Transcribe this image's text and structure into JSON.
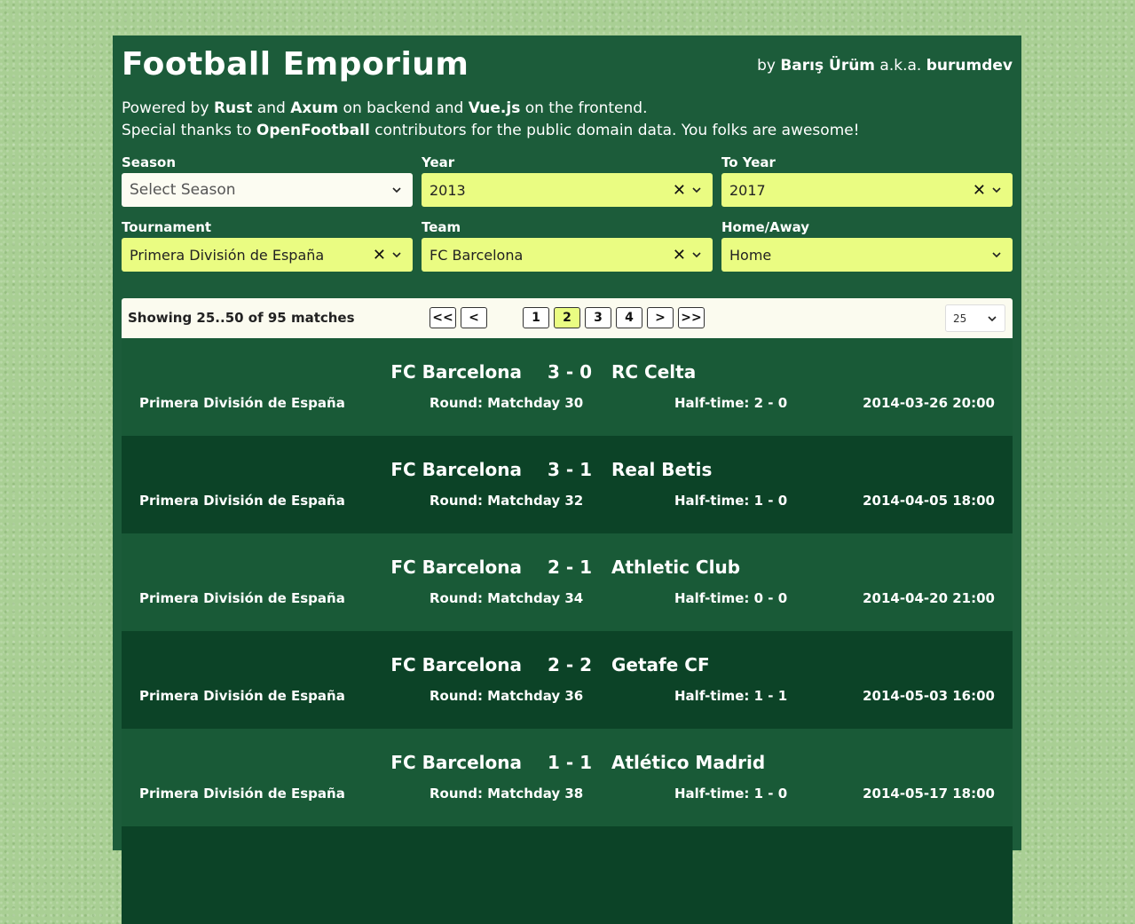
{
  "header": {
    "title": "Football Emporium",
    "by_prefix": "by ",
    "author": "Barış Ürüm",
    "aka": " a.k.a. ",
    "handle": "burumdev"
  },
  "intro": {
    "line1": [
      "Powered by ",
      "Rust",
      " and ",
      "Axum",
      " on backend and ",
      "Vue.js",
      " on the frontend."
    ],
    "line2": [
      "Special thanks to ",
      "OpenFootball",
      " contributors for the public domain data. You folks are awesome!"
    ]
  },
  "filters": {
    "season": {
      "label": "Season",
      "placeholder": "Select Season"
    },
    "year": {
      "label": "Year",
      "value": "2013"
    },
    "to_year": {
      "label": "To Year",
      "value": "2017"
    },
    "tournament": {
      "label": "Tournament",
      "value": "Primera División de España"
    },
    "team": {
      "label": "Team",
      "value": "FC Barcelona"
    },
    "home_away": {
      "label": "Home/Away",
      "value": "Home"
    }
  },
  "pager": {
    "showing": "Showing 25..50 of 95 matches",
    "first": "<<",
    "prev": "<",
    "pages": [
      "1",
      "2",
      "3",
      "4"
    ],
    "current_page": "2",
    "next": ">",
    "last": ">>",
    "per_page": "25"
  },
  "matches": [
    {
      "home": "FC Barcelona",
      "score": "3 - 0",
      "away": "RC Celta",
      "tournament": "Primera División de España",
      "round": "Round: Matchday 30",
      "halftime": "Half-time: 2 - 0",
      "date": "2014-03-26 20:00"
    },
    {
      "home": "FC Barcelona",
      "score": "3 - 1",
      "away": "Real Betis",
      "tournament": "Primera División de España",
      "round": "Round: Matchday 32",
      "halftime": "Half-time: 1 - 0",
      "date": "2014-04-05 18:00"
    },
    {
      "home": "FC Barcelona",
      "score": "2 - 1",
      "away": "Athletic Club",
      "tournament": "Primera División de España",
      "round": "Round: Matchday 34",
      "halftime": "Half-time: 0 - 0",
      "date": "2014-04-20 21:00"
    },
    {
      "home": "FC Barcelona",
      "score": "2 - 2",
      "away": "Getafe CF",
      "tournament": "Primera División de España",
      "round": "Round: Matchday 36",
      "halftime": "Half-time: 1 - 1",
      "date": "2014-05-03 16:00"
    },
    {
      "home": "FC Barcelona",
      "score": "1 - 1",
      "away": "Atlético Madrid",
      "tournament": "Primera División de España",
      "round": "Round: Matchday 38",
      "halftime": "Half-time: 1 - 0",
      "date": "2014-05-17 18:00"
    }
  ],
  "colors": {
    "panel": "#1c5c3a",
    "row_odd": "#195a37",
    "row_even": "#0c4327",
    "select_filled": "#eafc82",
    "grass": "#a9cf94"
  }
}
